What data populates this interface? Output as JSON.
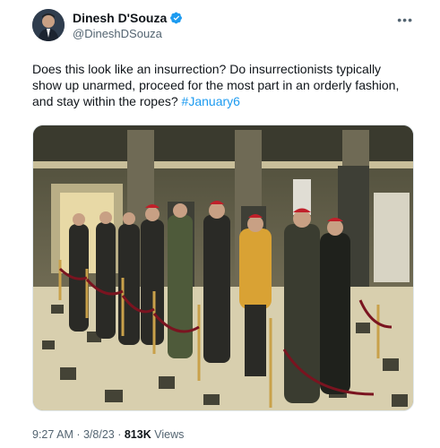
{
  "author": {
    "display_name": "Dinesh D'Souza",
    "handle": "@DineshDSouza",
    "verified": true
  },
  "tweet": {
    "text": "Does this look like an insurrection? Do insurrectionists typically show up unarmed,  proceed for the most part in an orderly fashion, and stay within the ropes? ",
    "hashtag": "#January6"
  },
  "media": {
    "description_icon": "photo-capitol-rotunda"
  },
  "meta": {
    "time": "9:27 AM",
    "separator": " · ",
    "date": "3/8/23",
    "views_count": "813K",
    "views_label": " Views"
  },
  "colors": {
    "accent": "#1d9bf0",
    "secondary_text": "#536471"
  }
}
